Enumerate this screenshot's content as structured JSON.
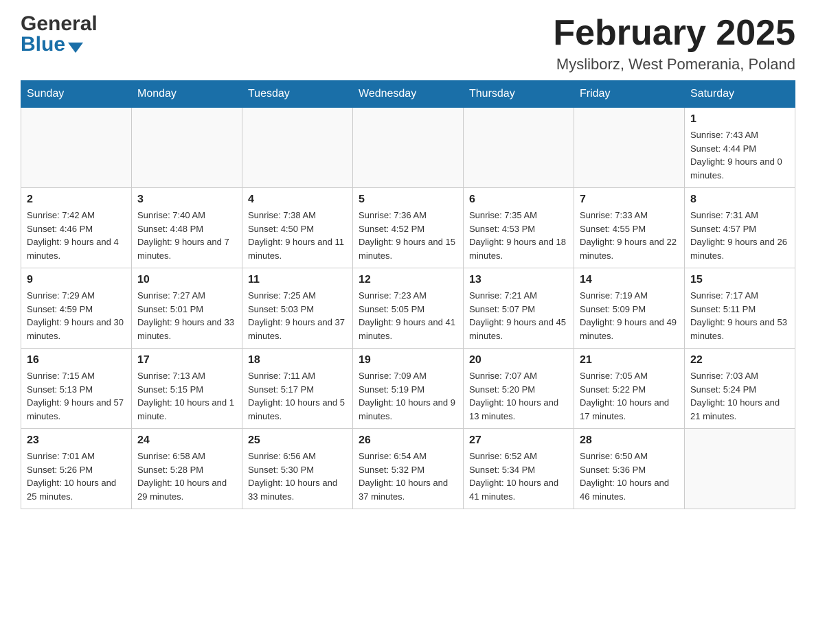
{
  "header": {
    "month_title": "February 2025",
    "location": "Mysliborz, West Pomerania, Poland",
    "logo_general": "General",
    "logo_blue": "Blue"
  },
  "weekdays": [
    "Sunday",
    "Monday",
    "Tuesday",
    "Wednesday",
    "Thursday",
    "Friday",
    "Saturday"
  ],
  "weeks": [
    [
      {
        "day": "",
        "sunrise": "",
        "sunset": "",
        "daylight": ""
      },
      {
        "day": "",
        "sunrise": "",
        "sunset": "",
        "daylight": ""
      },
      {
        "day": "",
        "sunrise": "",
        "sunset": "",
        "daylight": ""
      },
      {
        "day": "",
        "sunrise": "",
        "sunset": "",
        "daylight": ""
      },
      {
        "day": "",
        "sunrise": "",
        "sunset": "",
        "daylight": ""
      },
      {
        "day": "",
        "sunrise": "",
        "sunset": "",
        "daylight": ""
      },
      {
        "day": "1",
        "sunrise": "Sunrise: 7:43 AM",
        "sunset": "Sunset: 4:44 PM",
        "daylight": "Daylight: 9 hours and 0 minutes."
      }
    ],
    [
      {
        "day": "2",
        "sunrise": "Sunrise: 7:42 AM",
        "sunset": "Sunset: 4:46 PM",
        "daylight": "Daylight: 9 hours and 4 minutes."
      },
      {
        "day": "3",
        "sunrise": "Sunrise: 7:40 AM",
        "sunset": "Sunset: 4:48 PM",
        "daylight": "Daylight: 9 hours and 7 minutes."
      },
      {
        "day": "4",
        "sunrise": "Sunrise: 7:38 AM",
        "sunset": "Sunset: 4:50 PM",
        "daylight": "Daylight: 9 hours and 11 minutes."
      },
      {
        "day": "5",
        "sunrise": "Sunrise: 7:36 AM",
        "sunset": "Sunset: 4:52 PM",
        "daylight": "Daylight: 9 hours and 15 minutes."
      },
      {
        "day": "6",
        "sunrise": "Sunrise: 7:35 AM",
        "sunset": "Sunset: 4:53 PM",
        "daylight": "Daylight: 9 hours and 18 minutes."
      },
      {
        "day": "7",
        "sunrise": "Sunrise: 7:33 AM",
        "sunset": "Sunset: 4:55 PM",
        "daylight": "Daylight: 9 hours and 22 minutes."
      },
      {
        "day": "8",
        "sunrise": "Sunrise: 7:31 AM",
        "sunset": "Sunset: 4:57 PM",
        "daylight": "Daylight: 9 hours and 26 minutes."
      }
    ],
    [
      {
        "day": "9",
        "sunrise": "Sunrise: 7:29 AM",
        "sunset": "Sunset: 4:59 PM",
        "daylight": "Daylight: 9 hours and 30 minutes."
      },
      {
        "day": "10",
        "sunrise": "Sunrise: 7:27 AM",
        "sunset": "Sunset: 5:01 PM",
        "daylight": "Daylight: 9 hours and 33 minutes."
      },
      {
        "day": "11",
        "sunrise": "Sunrise: 7:25 AM",
        "sunset": "Sunset: 5:03 PM",
        "daylight": "Daylight: 9 hours and 37 minutes."
      },
      {
        "day": "12",
        "sunrise": "Sunrise: 7:23 AM",
        "sunset": "Sunset: 5:05 PM",
        "daylight": "Daylight: 9 hours and 41 minutes."
      },
      {
        "day": "13",
        "sunrise": "Sunrise: 7:21 AM",
        "sunset": "Sunset: 5:07 PM",
        "daylight": "Daylight: 9 hours and 45 minutes."
      },
      {
        "day": "14",
        "sunrise": "Sunrise: 7:19 AM",
        "sunset": "Sunset: 5:09 PM",
        "daylight": "Daylight: 9 hours and 49 minutes."
      },
      {
        "day": "15",
        "sunrise": "Sunrise: 7:17 AM",
        "sunset": "Sunset: 5:11 PM",
        "daylight": "Daylight: 9 hours and 53 minutes."
      }
    ],
    [
      {
        "day": "16",
        "sunrise": "Sunrise: 7:15 AM",
        "sunset": "Sunset: 5:13 PM",
        "daylight": "Daylight: 9 hours and 57 minutes."
      },
      {
        "day": "17",
        "sunrise": "Sunrise: 7:13 AM",
        "sunset": "Sunset: 5:15 PM",
        "daylight": "Daylight: 10 hours and 1 minute."
      },
      {
        "day": "18",
        "sunrise": "Sunrise: 7:11 AM",
        "sunset": "Sunset: 5:17 PM",
        "daylight": "Daylight: 10 hours and 5 minutes."
      },
      {
        "day": "19",
        "sunrise": "Sunrise: 7:09 AM",
        "sunset": "Sunset: 5:19 PM",
        "daylight": "Daylight: 10 hours and 9 minutes."
      },
      {
        "day": "20",
        "sunrise": "Sunrise: 7:07 AM",
        "sunset": "Sunset: 5:20 PM",
        "daylight": "Daylight: 10 hours and 13 minutes."
      },
      {
        "day": "21",
        "sunrise": "Sunrise: 7:05 AM",
        "sunset": "Sunset: 5:22 PM",
        "daylight": "Daylight: 10 hours and 17 minutes."
      },
      {
        "day": "22",
        "sunrise": "Sunrise: 7:03 AM",
        "sunset": "Sunset: 5:24 PM",
        "daylight": "Daylight: 10 hours and 21 minutes."
      }
    ],
    [
      {
        "day": "23",
        "sunrise": "Sunrise: 7:01 AM",
        "sunset": "Sunset: 5:26 PM",
        "daylight": "Daylight: 10 hours and 25 minutes."
      },
      {
        "day": "24",
        "sunrise": "Sunrise: 6:58 AM",
        "sunset": "Sunset: 5:28 PM",
        "daylight": "Daylight: 10 hours and 29 minutes."
      },
      {
        "day": "25",
        "sunrise": "Sunrise: 6:56 AM",
        "sunset": "Sunset: 5:30 PM",
        "daylight": "Daylight: 10 hours and 33 minutes."
      },
      {
        "day": "26",
        "sunrise": "Sunrise: 6:54 AM",
        "sunset": "Sunset: 5:32 PM",
        "daylight": "Daylight: 10 hours and 37 minutes."
      },
      {
        "day": "27",
        "sunrise": "Sunrise: 6:52 AM",
        "sunset": "Sunset: 5:34 PM",
        "daylight": "Daylight: 10 hours and 41 minutes."
      },
      {
        "day": "28",
        "sunrise": "Sunrise: 6:50 AM",
        "sunset": "Sunset: 5:36 PM",
        "daylight": "Daylight: 10 hours and 46 minutes."
      },
      {
        "day": "",
        "sunrise": "",
        "sunset": "",
        "daylight": ""
      }
    ]
  ]
}
